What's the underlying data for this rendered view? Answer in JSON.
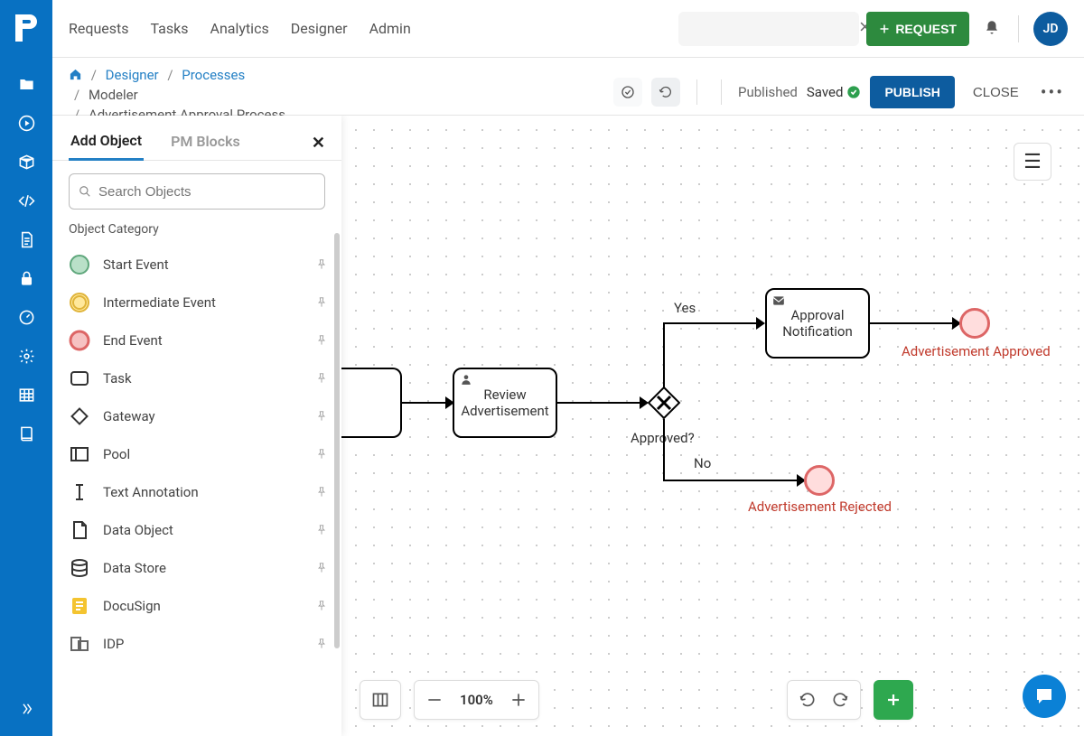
{
  "topnav": {
    "items": [
      "Requests",
      "Tasks",
      "Analytics",
      "Designer",
      "Admin"
    ],
    "search_placeholder": "",
    "request_btn": "REQUEST",
    "avatar_initials": "JD"
  },
  "breadcrumb": {
    "links": [
      "Designer",
      "Processes"
    ],
    "trail": [
      "Modeler",
      "Advertisement Approval Process"
    ],
    "status": "Published",
    "saved": "Saved",
    "publish_btn": "PUBLISH",
    "close_btn": "CLOSE"
  },
  "sidepanel": {
    "tabs": [
      "Add Object",
      "PM Blocks"
    ],
    "active_tab": 0,
    "search_placeholder": "Search Objects",
    "category_label": "Object Category",
    "objects": [
      {
        "label": "Start Event",
        "icon": "start-event"
      },
      {
        "label": "Intermediate Event",
        "icon": "intermediate-event"
      },
      {
        "label": "End Event",
        "icon": "end-event"
      },
      {
        "label": "Task",
        "icon": "task"
      },
      {
        "label": "Gateway",
        "icon": "gateway"
      },
      {
        "label": "Pool",
        "icon": "pool"
      },
      {
        "label": "Text Annotation",
        "icon": "text-annotation"
      },
      {
        "label": "Data Object",
        "icon": "data-object"
      },
      {
        "label": "Data Store",
        "icon": "data-store"
      },
      {
        "label": "DocuSign",
        "icon": "docusign"
      },
      {
        "label": "IDP",
        "icon": "idp"
      }
    ]
  },
  "canvas": {
    "task_review": "Review Advertisement",
    "task_notify": "Approval Notification",
    "gateway_label": "Approved?",
    "flow_yes": "Yes",
    "flow_no": "No",
    "end_approved": "Advertisement Approved",
    "end_rejected": "Advertisement Rejected"
  },
  "bottombar": {
    "zoom": "100%"
  }
}
